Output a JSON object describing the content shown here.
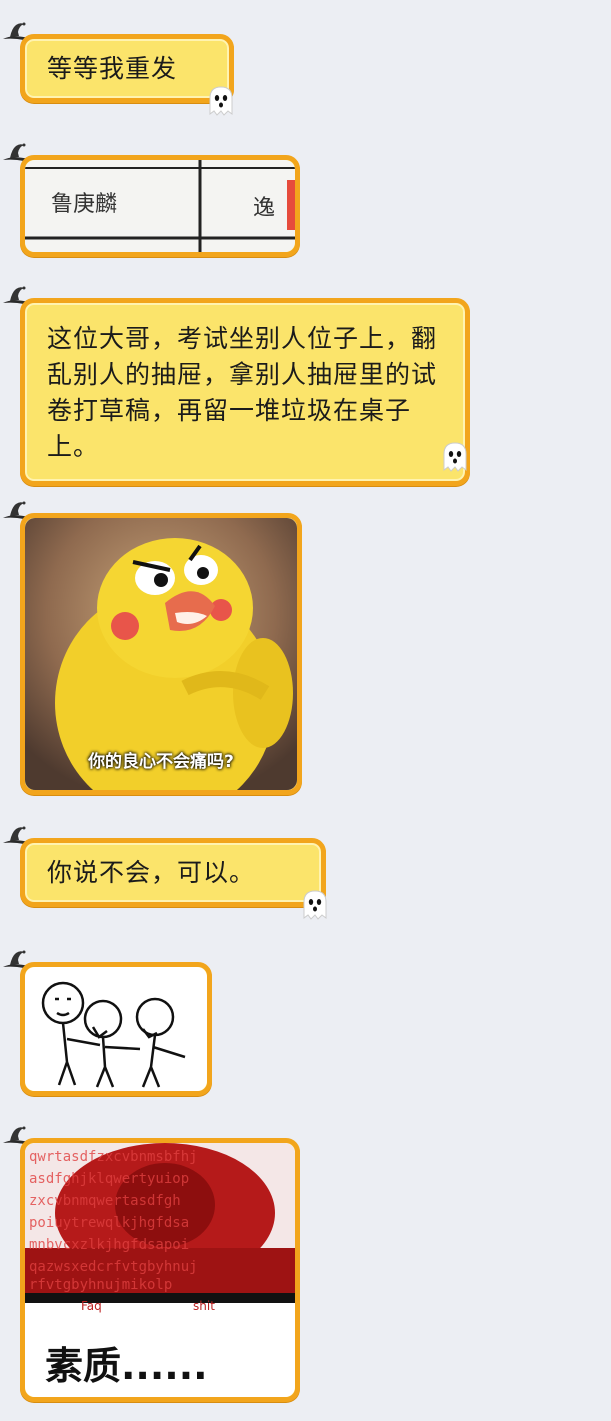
{
  "messages": [
    {
      "type": "text",
      "text": "等等我重发"
    },
    {
      "type": "image",
      "cells": [
        "鲁庚麟",
        "逸"
      ]
    },
    {
      "type": "text",
      "text": "这位大哥，考试坐别人位子上，翻乱别人的抽屉，拿别人抽屉里的试卷打草稿，再留一堆垃圾在桌子上。"
    },
    {
      "type": "image",
      "caption": "你的良心不会痛吗?"
    },
    {
      "type": "text",
      "text": "你说不会，可以。"
    },
    {
      "type": "image",
      "description_icon": "meme-stick-figures-icon"
    },
    {
      "type": "image",
      "labels": [
        "Faq",
        "shit"
      ],
      "caption": "素质......"
    }
  ],
  "icons": [
    "witch-hat-icon",
    "ghost-icon"
  ],
  "colors": {
    "bubble_fill": "#fbe46b",
    "bubble_border": "#f2a51c",
    "page_bg": "#eceef3"
  }
}
